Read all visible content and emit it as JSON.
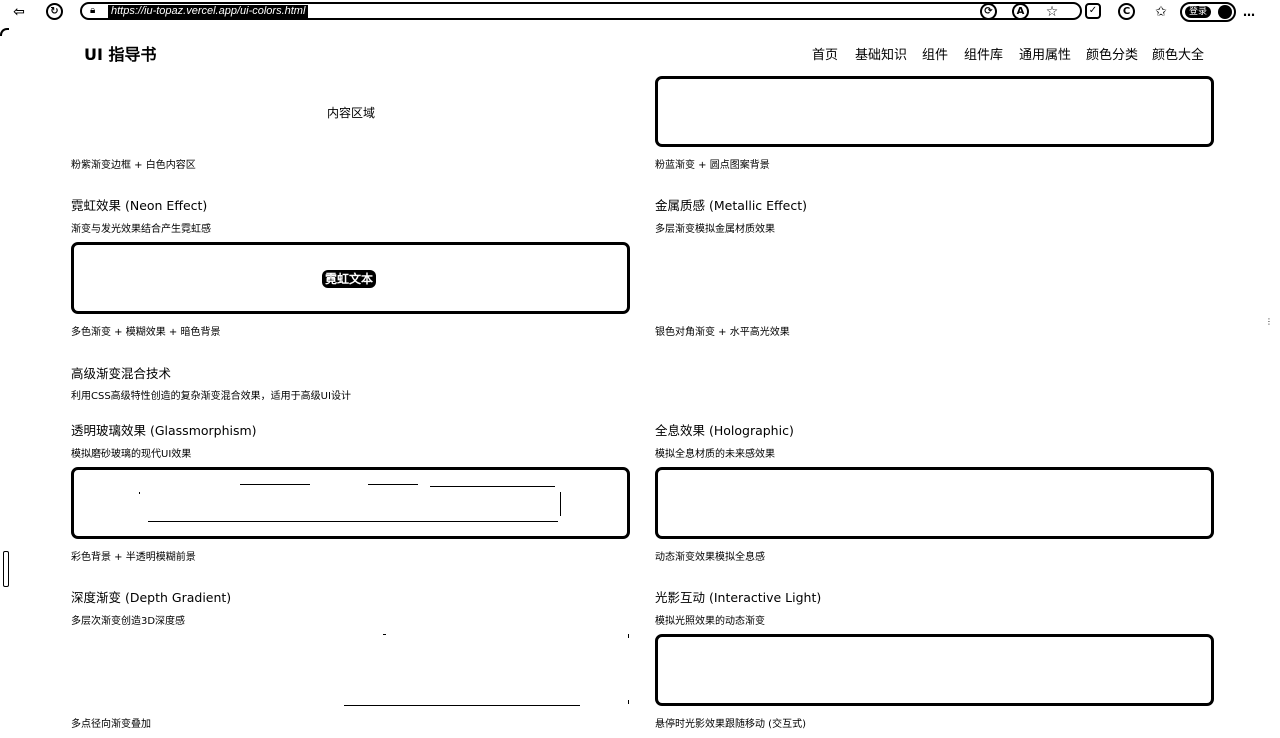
{
  "browser": {
    "url": "https://iu-topaz.vercel.app/ui-colors.html",
    "profile_label": "登录"
  },
  "site": {
    "brand": "UI 指导书",
    "nav": [
      "首页",
      "基础知识",
      "组件",
      "组件库",
      "通用属性",
      "颜色分类",
      "颜色大全"
    ]
  },
  "cards": {
    "border_gradient": {
      "preview_text": "内容区域",
      "caption": "粉紫渐变边框 + 白色内容区"
    },
    "dot_pattern": {
      "caption": "粉蓝渐变 + 圆点图案背景"
    },
    "neon": {
      "title": "霓虹效果 (Neon Effect)",
      "desc": "渐变与发光效果结合产生霓虹感",
      "preview_text": "霓虹文本",
      "caption": "多色渐变 + 模糊效果 + 暗色背景"
    },
    "metallic": {
      "title": "金属质感 (Metallic Effect)",
      "desc": "多层渐变模拟金属材质效果",
      "caption": "银色对角渐变 + 水平高光效果"
    },
    "glass": {
      "title": "透明玻璃效果 (Glassmorphism)",
      "desc": "模拟磨砂玻璃的现代UI效果",
      "caption": "彩色背景 + 半透明模糊前景"
    },
    "holographic": {
      "title": "全息效果 (Holographic)",
      "desc": "模拟全息材质的未来感效果",
      "caption": "动态渐变效果模拟全息感"
    },
    "depth": {
      "title": "深度渐变 (Depth Gradient)",
      "desc": "多层次渐变创造3D深度感",
      "caption": "多点径向渐变叠加"
    },
    "light": {
      "title": "光影互动 (Interactive Light)",
      "desc": "模拟光照效果的动态渐变",
      "caption": "悬停时光影效果跟随移动 (交互式)"
    }
  },
  "section": {
    "title": "高级渐变混合技术",
    "desc": "利用CSS高级特性创造的复杂渐变混合效果，适用于高级UI设计"
  }
}
